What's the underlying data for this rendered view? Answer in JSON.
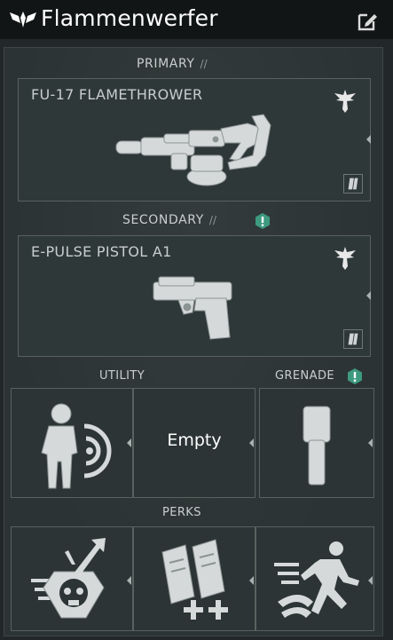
{
  "header": {
    "title": "Flammenwerfer",
    "logo_icon": "helldivers-wings-icon",
    "edit_icon": "edit-icon"
  },
  "loadout": {
    "primary": {
      "label": "PRIMARY",
      "slashes": "//",
      "weapon_name": "FU-17 FLAMETHROWER",
      "emblem_icon": "eagle-emblem-icon",
      "weapon_icon": "flamethrower-icon",
      "ammo_icon": "magazine-icon"
    },
    "secondary": {
      "label": "SECONDARY",
      "slashes": "//",
      "alert_icon": "alert-icon",
      "weapon_name": "E-PULSE PISTOL A1",
      "emblem_icon": "eagle-emblem-icon",
      "weapon_icon": "pistol-icon",
      "ammo_icon": "magazine-icon"
    },
    "utility": {
      "label": "UTILITY",
      "slots": [
        {
          "icon": "soldier-shield-icon",
          "text": ""
        },
        {
          "icon": "",
          "text": "Empty"
        }
      ]
    },
    "grenade": {
      "label": "GRENADE",
      "alert_icon": "alert-icon",
      "slot_icon": "grenade-canister-icon"
    },
    "perks": {
      "label": "PERKS",
      "items": [
        {
          "icon": "skull-badge-icon"
        },
        {
          "icon": "ammo-plus-icon"
        },
        {
          "icon": "sprint-icon"
        }
      ]
    }
  },
  "colors": {
    "accent_teal": "#3e9a7e",
    "frame_border": "#59625f",
    "header_bg": "#121516"
  }
}
